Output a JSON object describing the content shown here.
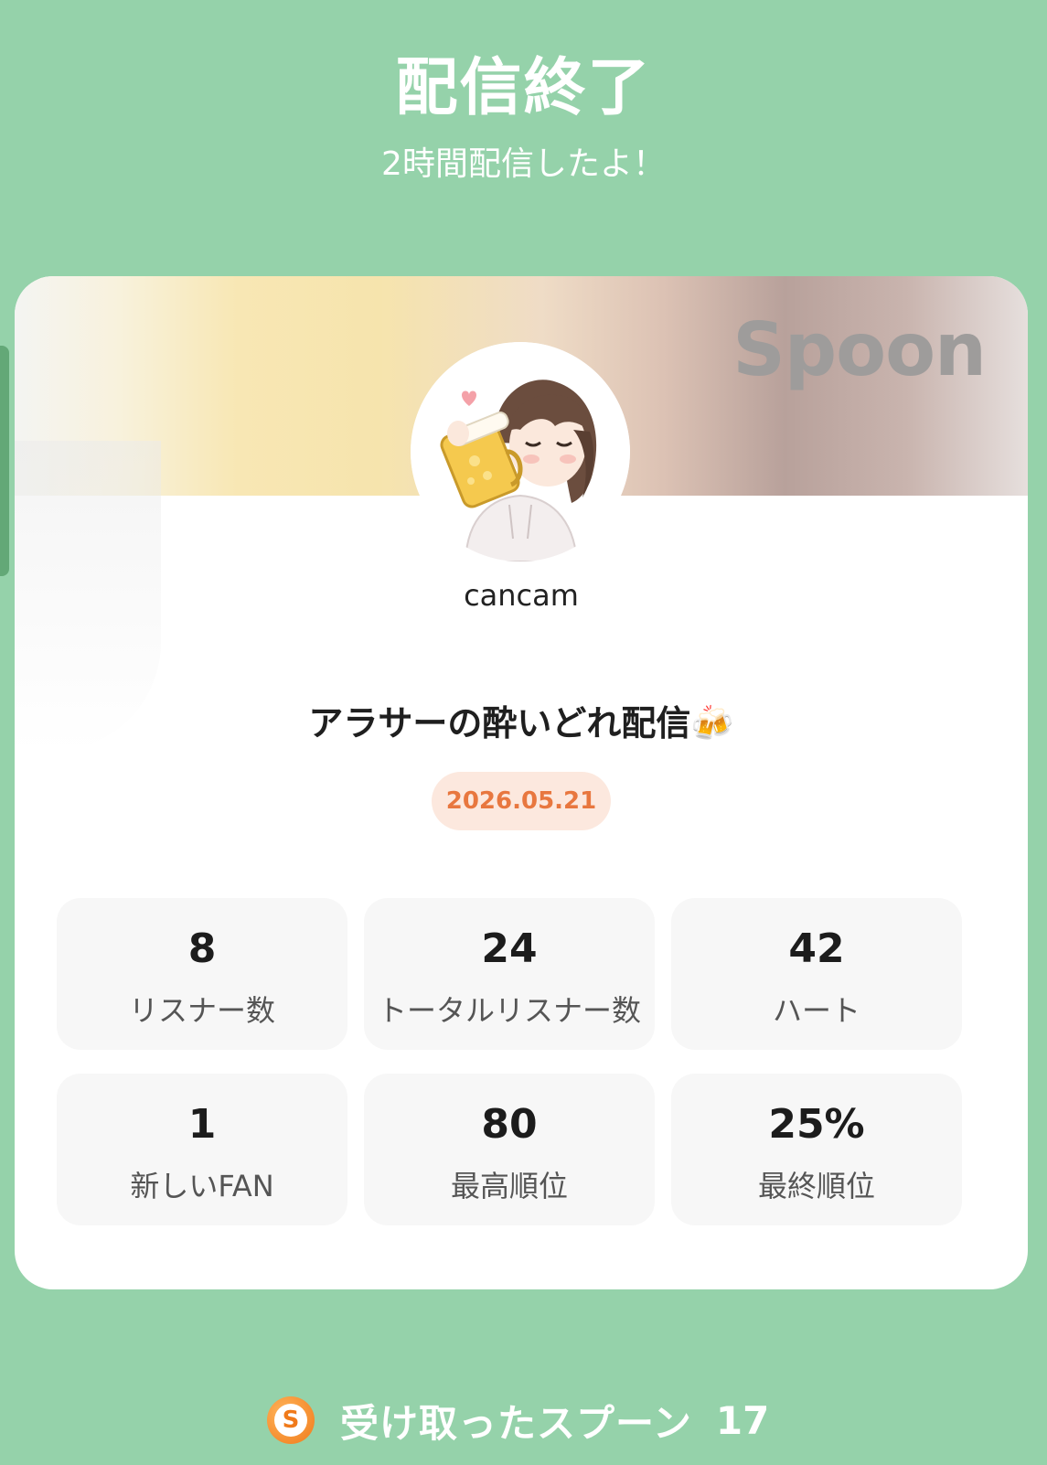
{
  "header": {
    "title": "配信終了",
    "subtitle": "2時間配信したよ！"
  },
  "card": {
    "brand": "Spoon",
    "username": "cancam",
    "stream_title": "アラサーの酔いどれ配信🍻",
    "date": "2026.05.21"
  },
  "stats": [
    {
      "value": "8",
      "label": "リスナー数"
    },
    {
      "value": "24",
      "label": "トータルリスナー数"
    },
    {
      "value": "42",
      "label": "ハート"
    },
    {
      "value": "1",
      "label": "新しいFAN"
    },
    {
      "value": "80",
      "label": "最高順位"
    },
    {
      "value": "25%",
      "label": "最終順位"
    }
  ],
  "footer": {
    "coin_letter": "S",
    "label": "受け取ったスプーン",
    "count": "17"
  },
  "colors": {
    "background": "#95d2aa",
    "accent": "#e8773f",
    "date_badge_bg": "#fce8de"
  },
  "icons": {
    "avatar": "avatar-illustration",
    "coin": "spoon-coin-icon"
  }
}
